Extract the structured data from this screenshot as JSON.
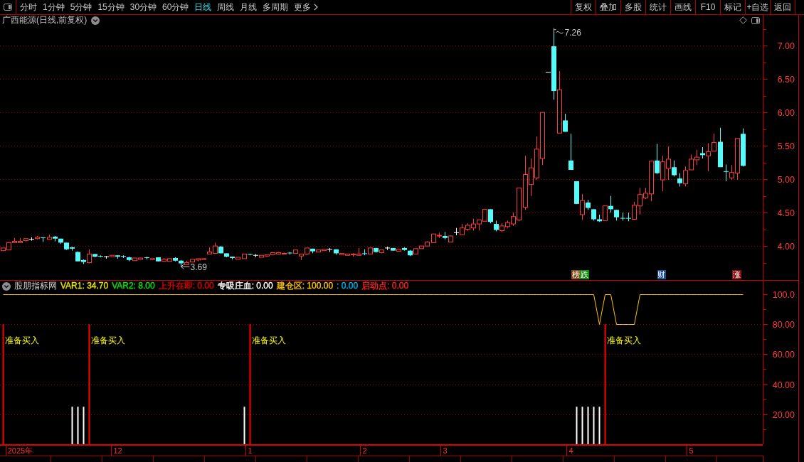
{
  "toolbar": {
    "periods": [
      {
        "label": "分时",
        "selected": false,
        "kind": "tab"
      },
      {
        "label": "1分钟",
        "selected": false,
        "kind": "tab"
      },
      {
        "label": "5分钟",
        "selected": false,
        "kind": "tab"
      },
      {
        "label": "15分钟",
        "selected": false,
        "kind": "tab"
      },
      {
        "label": "30分钟",
        "selected": false,
        "kind": "tab"
      },
      {
        "label": "60分钟",
        "selected": false,
        "kind": "tab"
      },
      {
        "label": "日线",
        "selected": true,
        "kind": "tab"
      },
      {
        "label": "周线",
        "selected": false,
        "kind": "tab"
      },
      {
        "label": "月线",
        "selected": false,
        "kind": "tab"
      },
      {
        "label": "多周期",
        "selected": false,
        "kind": "tab"
      },
      {
        "label": "更多",
        "selected": false,
        "kind": "menu"
      }
    ],
    "buttons": [
      "复权",
      "叠加",
      "多股",
      "统计",
      "画线",
      "F10",
      "标记",
      "+自选",
      "返回"
    ]
  },
  "main": {
    "title": "广西能源(日线,前复权)",
    "event_tags": [
      {
        "label": "榜",
        "color": "#8a4a14"
      },
      {
        "label": "跌",
        "color": "#118a11"
      },
      {
        "label": "财",
        "color": "#1c4f8c"
      },
      {
        "label": "涨",
        "color": "#8c0c0c"
      }
    ],
    "chart_data": [
      {
        "type": "candlestick",
        "ylim": [
          3.49,
          7.3
        ],
        "yticks": [
          {
            "value": 4,
            "label": "4.00"
          },
          {
            "value": 4.5,
            "label": "4.50"
          },
          {
            "value": 5,
            "label": "5.00"
          },
          {
            "value": 5.5,
            "label": "5.50"
          },
          {
            "value": 6,
            "label": "6.00"
          },
          {
            "value": 6.5,
            "label": "6.50"
          },
          {
            "value": 7,
            "label": "7.00"
          }
        ],
        "grid": true,
        "annotations": [
          "7.26",
          "3.69"
        ],
        "ohlc": [
          [
            3.93,
            3.97,
            3.93,
            3.97
          ],
          [
            3.94,
            4.06,
            3.94,
            4.05
          ],
          [
            4.05,
            4.12,
            4.05,
            4.07
          ],
          [
            4.05,
            4.12,
            4.05,
            4.07
          ],
          [
            4.08,
            4.11,
            4.07,
            4.11
          ],
          [
            4.1,
            4.13,
            4.08,
            4.1
          ],
          [
            4.11,
            4.15,
            4.1,
            4.13
          ],
          [
            4.13,
            4.13,
            4.06,
            4.12
          ],
          [
            4.1,
            4.17,
            4.1,
            4.13
          ],
          [
            4.14,
            4.15,
            4.07,
            4.11
          ],
          [
            4.11,
            4.11,
            4.03,
            4.05
          ],
          [
            4.05,
            4.05,
            3.94,
            3.95
          ],
          [
            3.98,
            3.99,
            3.93,
            3.96
          ],
          [
            3.91,
            3.92,
            3.77,
            3.77
          ],
          [
            3.79,
            3.8,
            3.73,
            3.76
          ],
          [
            3.75,
            3.95,
            3.74,
            3.88
          ],
          [
            3.88,
            3.88,
            3.83,
            3.84
          ],
          [
            3.85,
            3.86,
            3.83,
            3.84
          ],
          [
            3.84,
            3.85,
            3.81,
            3.84
          ],
          [
            3.84,
            3.86,
            3.84,
            3.86
          ],
          [
            3.86,
            3.86,
            3.81,
            3.84
          ],
          [
            3.85,
            3.86,
            3.82,
            3.84
          ],
          [
            3.83,
            3.84,
            3.77,
            3.79
          ],
          [
            3.78,
            3.82,
            3.78,
            3.82
          ],
          [
            3.8,
            3.82,
            3.8,
            3.82
          ],
          [
            3.83,
            3.84,
            3.8,
            3.82
          ],
          [
            3.8,
            3.81,
            3.8,
            3.81
          ],
          [
            3.83,
            3.83,
            3.77,
            3.77
          ],
          [
            3.77,
            3.82,
            3.77,
            3.8
          ],
          [
            3.77,
            3.81,
            3.77,
            3.81
          ],
          [
            3.82,
            3.83,
            3.77,
            3.78
          ],
          [
            3.78,
            3.79,
            3.69,
            3.74
          ],
          [
            3.72,
            3.78,
            3.72,
            3.75
          ],
          [
            3.76,
            3.8,
            3.76,
            3.8
          ],
          [
            3.79,
            3.81,
            3.77,
            3.81
          ],
          [
            3.8,
            3.81,
            3.8,
            3.81
          ],
          [
            3.88,
            3.98,
            3.88,
            3.91
          ],
          [
            3.89,
            4.05,
            3.89,
            4.0
          ],
          [
            3.99,
            4.0,
            3.89,
            3.89
          ],
          [
            3.89,
            3.89,
            3.83,
            3.84
          ],
          [
            3.84,
            3.84,
            3.8,
            3.82
          ],
          [
            3.8,
            3.83,
            3.8,
            3.83
          ],
          [
            3.81,
            3.88,
            3.81,
            3.88
          ],
          [
            3.88,
            3.88,
            3.86,
            3.87
          ],
          [
            3.86,
            3.88,
            3.83,
            3.86
          ],
          [
            3.83,
            3.86,
            3.83,
            3.86
          ],
          [
            3.85,
            3.87,
            3.84,
            3.87
          ],
          [
            3.87,
            3.91,
            3.86,
            3.9
          ],
          [
            3.88,
            3.91,
            3.87,
            3.9
          ],
          [
            3.88,
            3.9,
            3.88,
            3.89
          ],
          [
            3.9,
            3.91,
            3.87,
            3.89
          ],
          [
            3.89,
            3.94,
            3.89,
            3.94
          ],
          [
            3.85,
            3.88,
            3.79,
            3.88
          ],
          [
            3.88,
            3.97,
            3.86,
            3.97
          ],
          [
            3.96,
            3.96,
            3.89,
            3.92
          ],
          [
            3.91,
            3.94,
            3.91,
            3.94
          ],
          [
            3.93,
            3.95,
            3.93,
            3.95
          ],
          [
            3.95,
            3.97,
            3.91,
            3.95
          ],
          [
            3.95,
            3.95,
            3.87,
            3.89
          ],
          [
            3.87,
            3.89,
            3.87,
            3.89
          ],
          [
            3.86,
            3.88,
            3.86,
            3.88
          ],
          [
            3.87,
            3.89,
            3.84,
            3.88
          ],
          [
            3.86,
            3.97,
            3.86,
            3.88
          ],
          [
            3.89,
            3.95,
            3.86,
            3.88
          ],
          [
            3.88,
            3.97,
            3.88,
            3.97
          ],
          [
            3.97,
            3.97,
            3.9,
            3.91
          ],
          [
            3.9,
            3.94,
            3.89,
            3.94
          ],
          [
            3.97,
            3.99,
            3.94,
            3.97
          ],
          [
            3.97,
            3.97,
            3.93,
            3.93
          ],
          [
            3.92,
            3.95,
            3.92,
            3.95
          ],
          [
            3.97,
            3.98,
            3.93,
            3.94
          ],
          [
            3.93,
            3.94,
            3.85,
            3.86
          ],
          [
            3.88,
            3.96,
            3.88,
            3.96
          ],
          [
            3.96,
            4.0,
            3.96,
            4.0
          ],
          [
            4.0,
            4.07,
            4.0,
            4.06
          ],
          [
            4.05,
            4.18,
            4.05,
            4.18
          ],
          [
            4.15,
            4.2,
            4.12,
            4.16
          ],
          [
            4.15,
            4.21,
            4.1,
            4.12
          ],
          [
            4.06,
            4.16,
            4.06,
            4.15
          ],
          [
            4.2,
            4.27,
            4.16,
            4.2
          ],
          [
            4.17,
            4.33,
            4.17,
            4.27
          ],
          [
            4.25,
            4.34,
            4.23,
            4.31
          ],
          [
            4.27,
            4.41,
            4.23,
            4.33
          ],
          [
            4.33,
            4.39,
            4.23,
            4.39
          ],
          [
            4.37,
            4.55,
            4.37,
            4.55
          ],
          [
            4.55,
            4.55,
            4.34,
            4.36
          ],
          [
            4.33,
            4.38,
            4.22,
            4.24
          ],
          [
            4.23,
            4.34,
            4.21,
            4.3
          ],
          [
            4.29,
            4.38,
            4.27,
            4.35
          ],
          [
            4.33,
            4.5,
            4.3,
            4.44
          ],
          [
            4.39,
            4.87,
            4.37,
            4.87
          ],
          [
            4.58,
            5.35,
            4.54,
            5.07
          ],
          [
            4.92,
            5.31,
            4.75,
            5.17
          ],
          [
            5.02,
            5.64,
            4.99,
            5.45
          ],
          [
            5.31,
            6.0,
            5.21,
            6.0
          ],
          [
            6.6,
            6.6,
            6.6,
            6.6
          ],
          [
            6.99,
            7.26,
            6.19,
            6.32
          ],
          [
            5.69,
            6.62,
            5.69,
            6.34
          ],
          [
            5.88,
            5.98,
            5.71,
            5.71
          ],
          [
            5.28,
            5.68,
            5.14,
            5.14
          ],
          [
            4.97,
            4.97,
            4.63,
            4.63
          ],
          [
            4.47,
            4.78,
            4.39,
            4.68
          ],
          [
            4.65,
            4.69,
            4.54,
            4.57
          ],
          [
            4.55,
            4.55,
            4.38,
            4.4
          ],
          [
            4.4,
            4.47,
            4.36,
            4.37
          ],
          [
            4.38,
            4.6,
            4.38,
            4.6
          ],
          [
            4.6,
            4.75,
            4.5,
            4.55
          ],
          [
            4.54,
            4.54,
            4.38,
            4.43
          ],
          [
            4.42,
            4.5,
            4.38,
            4.41
          ],
          [
            4.42,
            4.5,
            4.37,
            4.41
          ],
          [
            4.4,
            4.66,
            4.39,
            4.61
          ],
          [
            4.6,
            4.87,
            4.47,
            4.77
          ],
          [
            4.72,
            4.87,
            4.7,
            4.79
          ],
          [
            4.78,
            5.27,
            4.67,
            5.27
          ],
          [
            5.28,
            5.53,
            5.08,
            5.09
          ],
          [
            4.99,
            5.35,
            4.82,
            5.26
          ],
          [
            5.16,
            5.49,
            4.99,
            5.3
          ],
          [
            5.18,
            5.28,
            5.04,
            5.06
          ],
          [
            5.01,
            5.09,
            4.89,
            4.94
          ],
          [
            4.93,
            5.19,
            4.89,
            5.13
          ],
          [
            5.14,
            5.37,
            5.14,
            5.3
          ],
          [
            5.29,
            5.44,
            5.21,
            5.33
          ],
          [
            5.39,
            5.48,
            5.31,
            5.36
          ],
          [
            5.35,
            5.54,
            5.12,
            5.41
          ],
          [
            5.42,
            5.68,
            5.42,
            5.55
          ],
          [
            5.56,
            5.77,
            5.18,
            5.18
          ],
          [
            5.12,
            5.22,
            4.97,
            5.11
          ],
          [
            5.02,
            5.21,
            4.99,
            5.1
          ],
          [
            5.09,
            5.61,
            4.99,
            5.61
          ],
          [
            5.68,
            5.76,
            5.19,
            5.2
          ],
          null,
          null,
          null
        ]
      }
    ]
  },
  "indicator": {
    "name": "股朋指标网",
    "readouts": [
      {
        "text": "VAR1: 34.70",
        "color": "#e6e600"
      },
      {
        "text": "VAR2: 8.00",
        "color": "#00e600"
      },
      {
        "text": "上升在即: 0.00",
        "color": "#e60000"
      },
      {
        "text": "专吸庄血: 0.00",
        "color": "#ffffff"
      },
      {
        "text": "建仓区: 100.00",
        "color": "#ffc400"
      },
      {
        "text": ": 0.00",
        "color": "#00b4f0"
      },
      {
        "text": "启动点: 0.00",
        "color": "#ff2020"
      }
    ],
    "chart_data": [
      {
        "type": "line",
        "ylim": [
          0,
          109
        ],
        "grid": true,
        "yticks": [
          {
            "value": 20,
            "label": "20.00"
          },
          {
            "value": 40,
            "label": "40.00"
          },
          {
            "value": 60,
            "label": "60.00"
          },
          {
            "value": 80,
            "label": "80.00"
          },
          {
            "value": 100,
            "label": "100.0"
          }
        ],
        "annotations": [
          "准备买入",
          "准备买入",
          "准备买入",
          "准备买入"
        ],
        "categories": [
          null,
          null,
          null,
          "2025年",
          null,
          null,
          null,
          null,
          null,
          null,
          null,
          null,
          null,
          null,
          null,
          null,
          null,
          null,
          null,
          null,
          "12",
          null,
          null,
          null,
          null,
          null,
          null,
          null,
          null,
          null,
          null,
          null,
          null,
          null,
          null,
          null,
          null,
          null,
          null,
          null,
          null,
          null,
          null,
          "1",
          null,
          null,
          null,
          null,
          null,
          null,
          null,
          null,
          null,
          null,
          null,
          null,
          null,
          null,
          null,
          null,
          null,
          null,
          null,
          "2",
          null,
          null,
          null,
          null,
          null,
          null,
          null,
          null,
          null,
          null,
          null,
          null,
          null,
          "3",
          null,
          null,
          null,
          null,
          null,
          null,
          null,
          null,
          null,
          null,
          null,
          null,
          null,
          null,
          null,
          null,
          null,
          null,
          null,
          null,
          null,
          "4",
          null,
          null,
          null,
          null,
          null,
          null,
          null,
          null,
          null,
          null,
          null,
          null,
          null,
          null,
          null,
          null,
          null,
          null,
          null,
          null,
          "5",
          null,
          null,
          null,
          null,
          null,
          null,
          null,
          null,
          null,
          null,
          null,
          null
        ],
        "series": [
          {
            "type": "line",
            "color": "#ffc400",
            "values": [
              100,
              100,
              100,
              100,
              100,
              100,
              100,
              100,
              100,
              100,
              100,
              100,
              100,
              100,
              100,
              100,
              100,
              100,
              100,
              100,
              100,
              100,
              100,
              100,
              100,
              100,
              100,
              100,
              100,
              100,
              100,
              100,
              100,
              100,
              100,
              100,
              100,
              100,
              100,
              100,
              100,
              100,
              100,
              100,
              100,
              100,
              100,
              100,
              100,
              100,
              100,
              100,
              100,
              100,
              100,
              100,
              100,
              100,
              100,
              100,
              100,
              100,
              100,
              100,
              100,
              100,
              100,
              100,
              100,
              100,
              100,
              100,
              100,
              100,
              100,
              100,
              100,
              100,
              100,
              100,
              100,
              100,
              100,
              100,
              100,
              100,
              100,
              100,
              100,
              100,
              100,
              100,
              100,
              100,
              100,
              100,
              100,
              100,
              100,
              100,
              100,
              100,
              100,
              100,
              80,
              100,
              100,
              80,
              80,
              80,
              80,
              100,
              100,
              100,
              100,
              100,
              100,
              100,
              100,
              100,
              100,
              100,
              100,
              100,
              100,
              100,
              100,
              100,
              100,
              100,
              null,
              null,
              null
            ]
          },
          {
            "type": "bar",
            "color": "#ff0000",
            "values": [
              80,
              null,
              null,
              null,
              null,
              null,
              null,
              null,
              null,
              null,
              null,
              null,
              null,
              null,
              null,
              80,
              null,
              null,
              null,
              null,
              null,
              null,
              null,
              null,
              null,
              null,
              null,
              null,
              null,
              null,
              null,
              null,
              null,
              null,
              null,
              null,
              null,
              null,
              null,
              null,
              null,
              null,
              null,
              80,
              null,
              null,
              null,
              null,
              null,
              null,
              null,
              null,
              null,
              null,
              null,
              null,
              null,
              null,
              null,
              null,
              null,
              null,
              null,
              null,
              null,
              null,
              null,
              null,
              null,
              null,
              null,
              null,
              null,
              null,
              null,
              null,
              null,
              null,
              null,
              null,
              null,
              null,
              null,
              null,
              null,
              null,
              null,
              null,
              null,
              null,
              null,
              null,
              null,
              null,
              null,
              null,
              null,
              null,
              null,
              null,
              null,
              null,
              null,
              null,
              null,
              80,
              null,
              null,
              null,
              null,
              null,
              null,
              null,
              null,
              null,
              null,
              null,
              null,
              null,
              null,
              null,
              null,
              null,
              null,
              null,
              null,
              null,
              null,
              null,
              null,
              null,
              null,
              null
            ]
          },
          {
            "type": "bar",
            "color": "#ffffff",
            "values": [
              null,
              null,
              null,
              null,
              null,
              null,
              null,
              null,
              null,
              null,
              null,
              null,
              25,
              25,
              25,
              null,
              null,
              null,
              null,
              null,
              null,
              null,
              null,
              null,
              null,
              null,
              null,
              null,
              null,
              null,
              null,
              null,
              null,
              null,
              null,
              null,
              null,
              null,
              null,
              null,
              null,
              null,
              25,
              null,
              null,
              null,
              null,
              null,
              null,
              null,
              null,
              null,
              null,
              null,
              null,
              null,
              null,
              null,
              null,
              null,
              null,
              null,
              null,
              null,
              null,
              null,
              null,
              null,
              null,
              null,
              null,
              null,
              null,
              null,
              null,
              null,
              null,
              null,
              null,
              null,
              null,
              null,
              null,
              null,
              null,
              null,
              null,
              null,
              null,
              null,
              null,
              null,
              null,
              null,
              null,
              null,
              null,
              null,
              null,
              null,
              25,
              25,
              25,
              25,
              25,
              null,
              null,
              null,
              null,
              null,
              null,
              null,
              null,
              null,
              null,
              null,
              null,
              null,
              null,
              null,
              null,
              null,
              null,
              null,
              null,
              null,
              null,
              null,
              null,
              null,
              null,
              null,
              null
            ]
          }
        ]
      }
    ]
  }
}
